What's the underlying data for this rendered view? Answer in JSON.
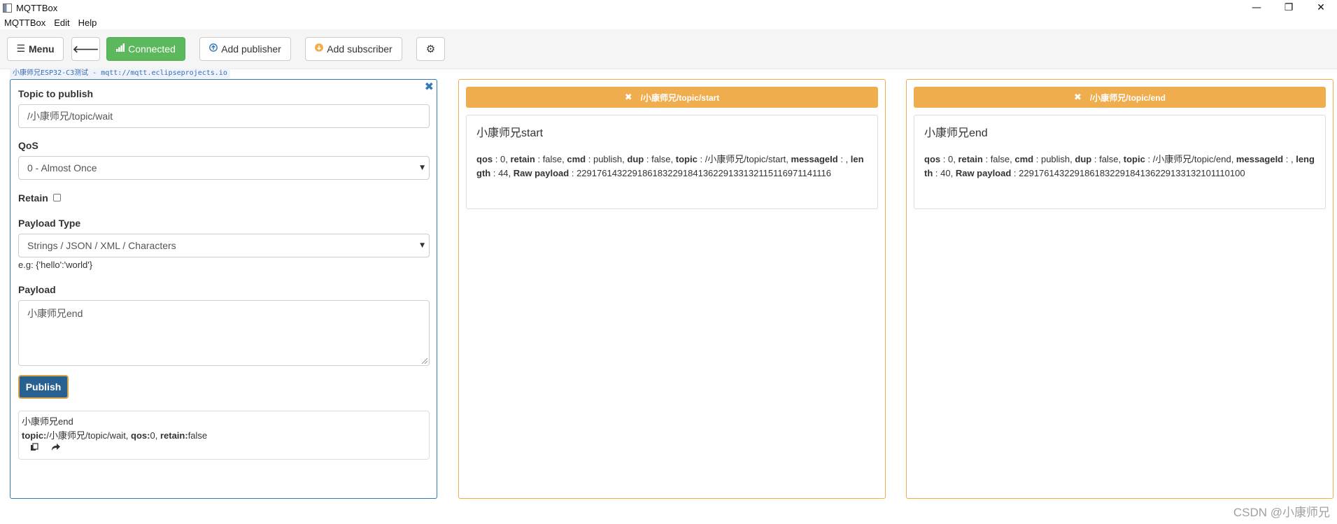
{
  "window": {
    "title": "MQTTBox",
    "controls": {
      "minimize": "—",
      "restore": "❐",
      "close": "✕"
    }
  },
  "menubar": {
    "items": [
      "MQTTBox",
      "Edit",
      "Help"
    ]
  },
  "toolbar": {
    "menu_label": "Menu",
    "back_icon": "arrow-left-icon",
    "connected_label": "Connected",
    "add_publisher_label": "Add publisher",
    "add_subscriber_label": "Add subscriber",
    "settings_icon": "gear-icon",
    "colors": {
      "connected": "#5cb85c"
    }
  },
  "connection_tag": "小康师兄ESP32-C3测试 - mqtt://mqtt.eclipseprojects.io",
  "publisher": {
    "topic_label": "Topic to publish",
    "topic_value": "/小康师兄/topic/wait",
    "qos_label": "QoS",
    "qos_value": "0 - Almost Once",
    "retain_label": "Retain",
    "retain_checked": false,
    "payload_type_label": "Payload Type",
    "payload_type_value": "Strings / JSON / XML / Characters",
    "payload_type_hint": "e.g: {'hello':'world'}",
    "payload_label": "Payload",
    "payload_value": "小康师兄end",
    "publish_label": "Publish",
    "history": {
      "payload": "小康师兄end",
      "topic_key": "topic:",
      "topic_value": "/小康师兄/topic/wait, ",
      "qos_key": "qos:",
      "qos_value": "0, ",
      "retain_key": "retain:",
      "retain_value": "false"
    }
  },
  "subscribers": [
    {
      "topic": "/小康师兄/topic/start",
      "message": {
        "payload": "小康师兄start",
        "qos": "0",
        "retain": "false",
        "cmd": "publish",
        "dup": "false",
        "topic": "/小康师兄/topic/start",
        "messageId": "",
        "length": "44",
        "raw_payload": "229176143229186183229184136229133132115116971141116"
      }
    },
    {
      "topic": "/小康师兄/topic/end",
      "message": {
        "payload": "小康师兄end",
        "qos": "0",
        "retain": "false",
        "cmd": "publish",
        "dup": "false",
        "topic": "/小康师兄/topic/end",
        "messageId": "",
        "length": "40",
        "raw_payload": "229176143229186183229184136229133132101110100"
      }
    }
  ],
  "watermark": "CSDN @小康师兄"
}
